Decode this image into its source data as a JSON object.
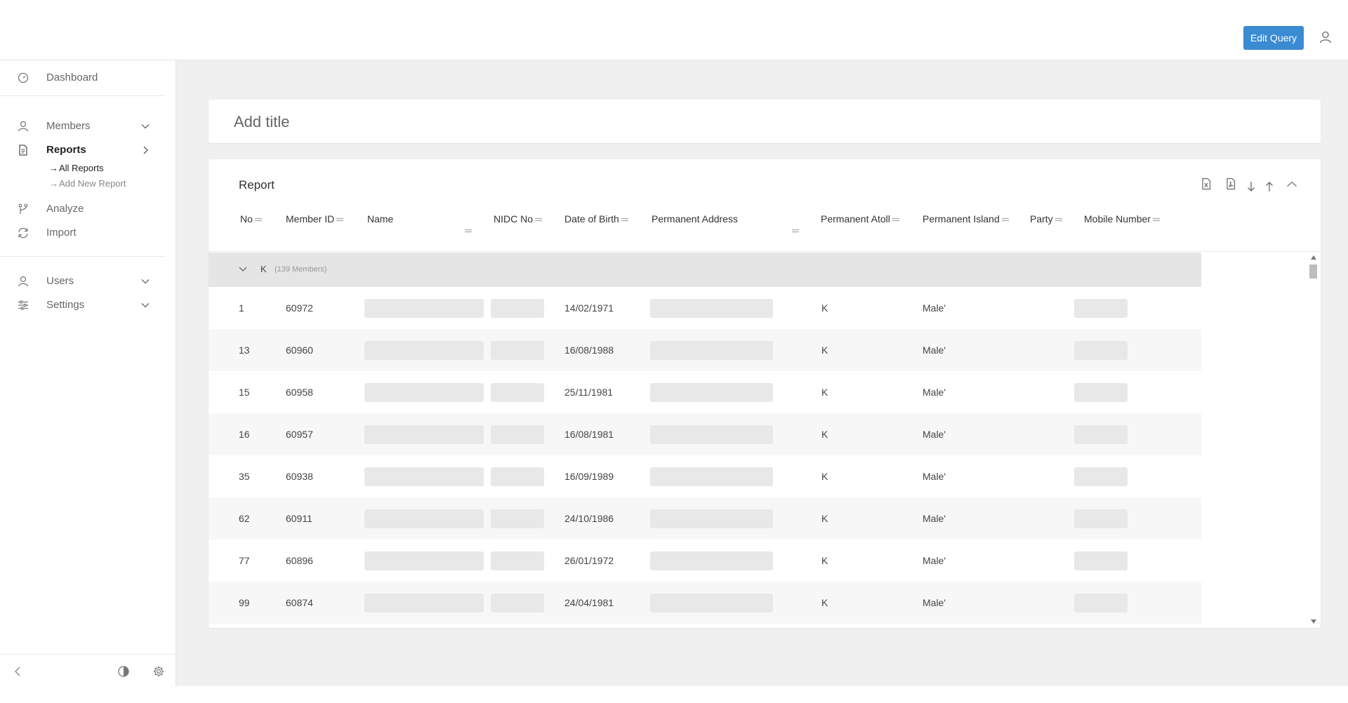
{
  "header": {
    "edit_query_label": "Edit Query"
  },
  "sidebar": {
    "dashboard": "Dashboard",
    "members": "Members",
    "reports": "Reports",
    "reports_sub": [
      "All Reports",
      "Add New Report"
    ],
    "analyze": "Analyze",
    "import": "Import",
    "users": "Users",
    "settings": "Settings"
  },
  "title_card": {
    "placeholder": "Add title"
  },
  "report": {
    "title": "Report",
    "columns": [
      "No",
      "Member ID",
      "Name",
      "NIDC No",
      "Date of Birth",
      "Permanent Address",
      "Permanent Atoll",
      "Permanent Island",
      "Party",
      "Mobile Number"
    ],
    "group": {
      "name": "K",
      "count": "(139 Members)"
    },
    "rows": [
      {
        "no": "1",
        "member_id": "60972",
        "dob": "14/02/1971",
        "atoll": "K",
        "island": "Male'"
      },
      {
        "no": "13",
        "member_id": "60960",
        "dob": "16/08/1988",
        "atoll": "K",
        "island": "Male'"
      },
      {
        "no": "15",
        "member_id": "60958",
        "dob": "25/11/1981",
        "atoll": "K",
        "island": "Male'"
      },
      {
        "no": "16",
        "member_id": "60957",
        "dob": "16/08/1981",
        "atoll": "K",
        "island": "Male'"
      },
      {
        "no": "35",
        "member_id": "60938",
        "dob": "16/09/1989",
        "atoll": "K",
        "island": "Male'"
      },
      {
        "no": "62",
        "member_id": "60911",
        "dob": "24/10/1986",
        "atoll": "K",
        "island": "Male'"
      },
      {
        "no": "77",
        "member_id": "60896",
        "dob": "26/01/1972",
        "atoll": "K",
        "island": "Male'"
      },
      {
        "no": "99",
        "member_id": "60874",
        "dob": "24/04/1981",
        "atoll": "K",
        "island": "Male'"
      }
    ]
  },
  "icons": {
    "user": "user-icon",
    "dashboard": "gauge-icon",
    "reports": "document-icon",
    "analyze": "branch-icon",
    "import": "refresh-icon",
    "settings": "sliders-icon",
    "excel": "excel-file-icon",
    "pdf": "pdf-file-icon"
  },
  "colors": {
    "accent": "#3b8bd3",
    "group_bg": "#e5e5e5",
    "main_bg": "#f0f0f0"
  }
}
